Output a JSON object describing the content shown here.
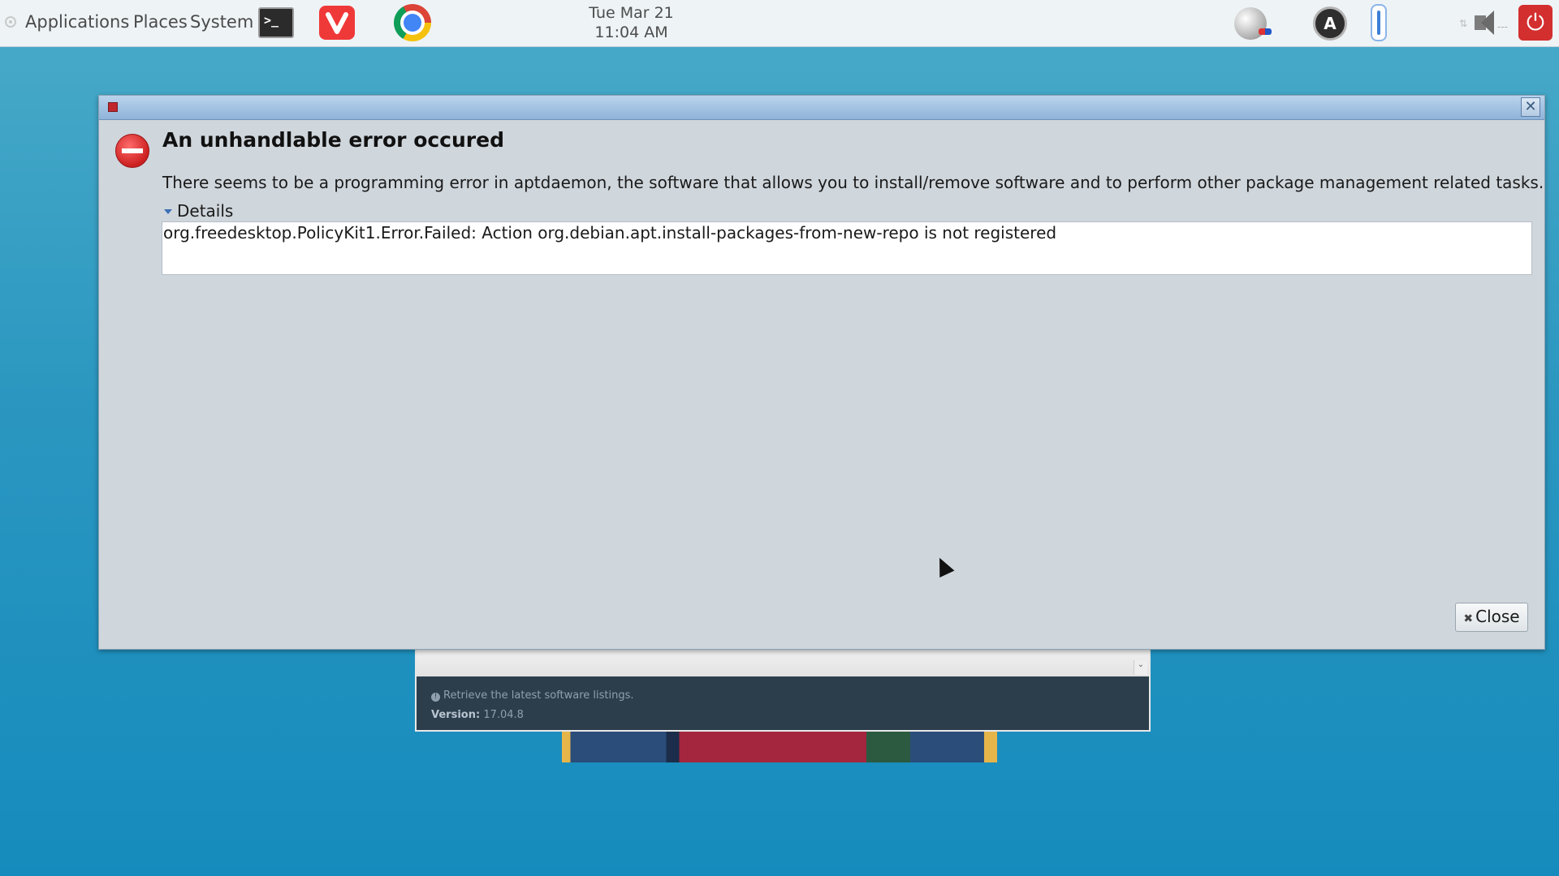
{
  "panel": {
    "menus": [
      "Applications",
      "Places",
      "System"
    ],
    "terminal_glyph": ">_",
    "vivaldi_glyph": "V",
    "clock_date": "Tue Mar 21",
    "clock_time": "11:04 AM",
    "update_glyph": "A",
    "power_glyph": "⏻",
    "icons": [
      "terminal-icon",
      "vivaldi-icon",
      "chrome-icon",
      "globe-icon",
      "software-update-icon",
      "thermometer-icon",
      "network-icon",
      "volume-icon",
      "power-icon"
    ]
  },
  "background_window": {
    "info_text": "Retrieve the latest software listings.",
    "version_label": "Version:",
    "version_value": "17.04.8"
  },
  "dialog": {
    "close_glyph": "✕",
    "heading": "An unhandlable error occured",
    "message": "There seems to be a programming error in aptdaemon, the software that allows you to install/remove software and to perform other package management related tasks.",
    "details_label": "Details",
    "details_text": "org.freedesktop.PolicyKit1.Error.Failed: Action org.debian.apt.install-packages-from-new-repo is not registered",
    "close_button": "Close",
    "close_button_glyph": "✖"
  },
  "colors": {
    "desktop": "#2b97c0",
    "dialog_bg": "#cfd6dc",
    "titlebar": "#8fb3d9",
    "error_red": "#cc1f1f"
  }
}
